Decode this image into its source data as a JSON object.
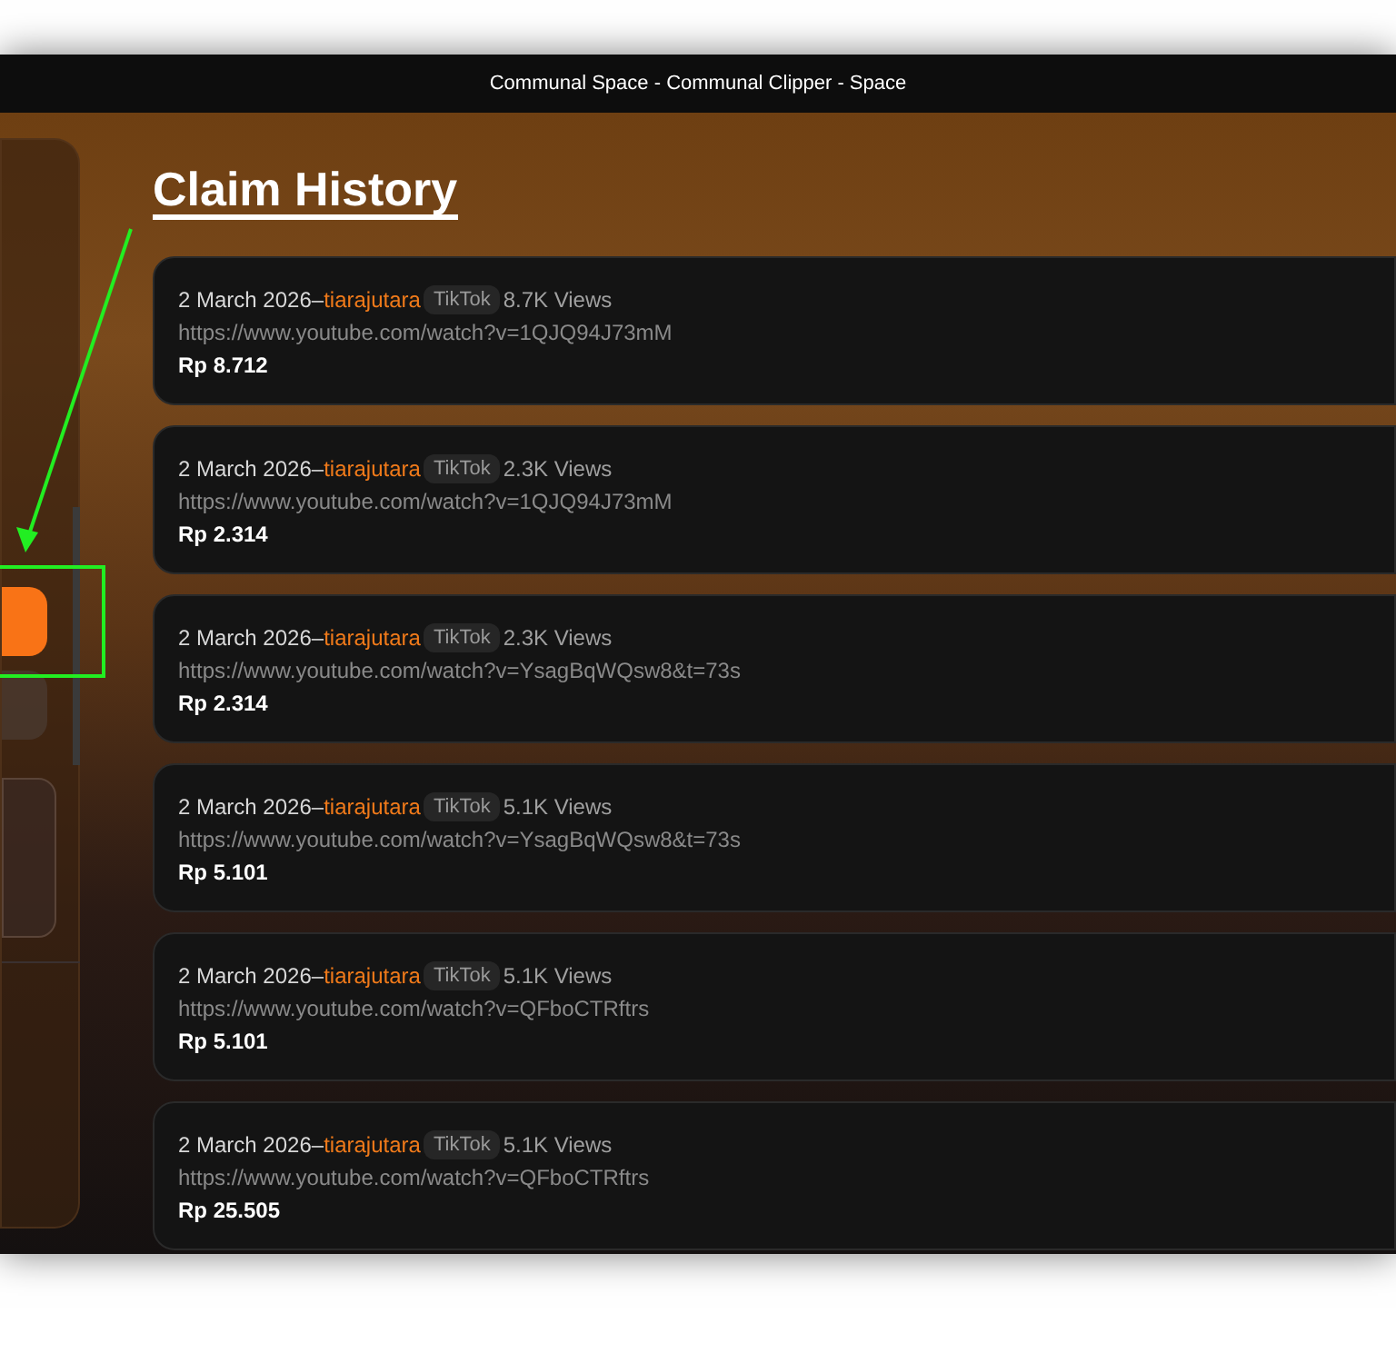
{
  "window": {
    "title": "Communal Space - Communal Clipper - Space"
  },
  "heading": "Claim History",
  "claims": [
    {
      "date": "2 March 2026",
      "separator": "–",
      "user": "tiarajutara",
      "platform": "TikTok",
      "views": "8.7K Views",
      "url": "https://www.youtube.com/watch?v=1QJQ94J73mM",
      "amount": "Rp 8.712"
    },
    {
      "date": "2 March 2026",
      "separator": "–",
      "user": "tiarajutara",
      "platform": "TikTok",
      "views": "2.3K Views",
      "url": "https://www.youtube.com/watch?v=1QJQ94J73mM",
      "amount": "Rp 2.314"
    },
    {
      "date": "2 March 2026",
      "separator": "–",
      "user": "tiarajutara",
      "platform": "TikTok",
      "views": "2.3K Views",
      "url": "https://www.youtube.com/watch?v=YsagBqWQsw8&t=73s",
      "amount": "Rp 2.314"
    },
    {
      "date": "2 March 2026",
      "separator": "–",
      "user": "tiarajutara",
      "platform": "TikTok",
      "views": "5.1K Views",
      "url": "https://www.youtube.com/watch?v=YsagBqWQsw8&t=73s",
      "amount": "Rp 5.101"
    },
    {
      "date": "2 March 2026",
      "separator": "–",
      "user": "tiarajutara",
      "platform": "TikTok",
      "views": "5.1K Views",
      "url": "https://www.youtube.com/watch?v=QFboCTRftrs",
      "amount": "Rp 5.101"
    },
    {
      "date": "2 March 2026",
      "separator": "–",
      "user": "tiarajutara",
      "platform": "TikTok",
      "views": "5.1K Views",
      "url": "https://www.youtube.com/watch?v=QFboCTRftrs",
      "amount": "Rp 25.505"
    }
  ]
}
